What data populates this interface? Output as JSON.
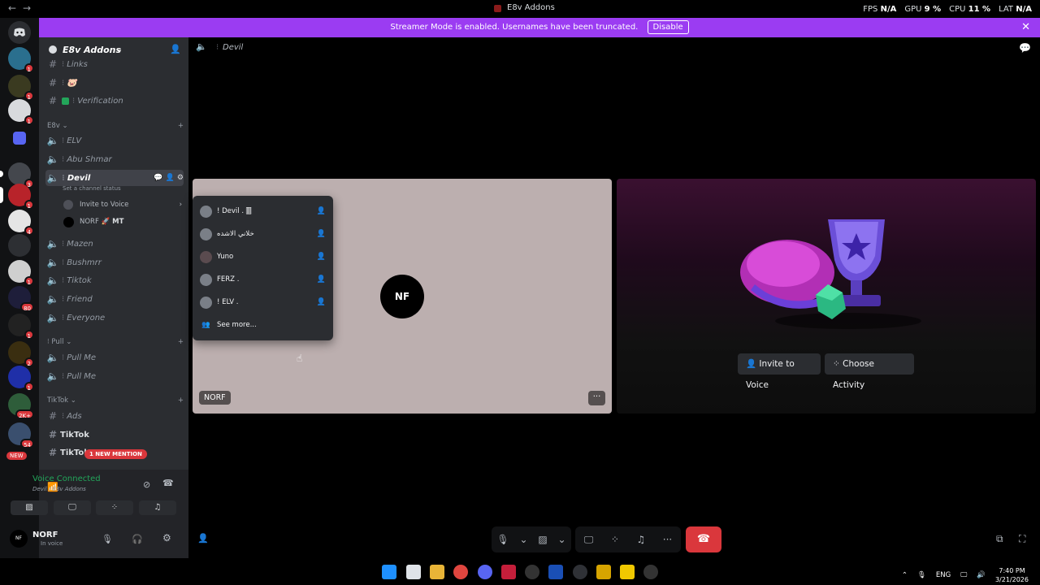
{
  "titlebar": {
    "back": "←",
    "forward": "→",
    "title": "E8v Addons",
    "fps_label": "FPS",
    "fps": "N/A",
    "gpu_label": "GPU",
    "gpu": "9 %",
    "cpu_label": "CPU",
    "cpu": "11 %",
    "lat_label": "LAT",
    "lat": "N/A"
  },
  "banner": {
    "text": "Streamer Mode is enabled. Usernames have been truncated.",
    "button": "Disable",
    "close": "✕"
  },
  "rail": {
    "badges": [
      "1",
      "1",
      "1",
      "3",
      "1",
      "4",
      "1",
      "80",
      "1",
      "2",
      "1",
      "2K+",
      "54"
    ],
    "new_label": "NEW"
  },
  "server": {
    "name": "E8v Addons"
  },
  "channels": {
    "links": "Links",
    "emoji_channel": "🐷",
    "verification": "Verification",
    "cat_e8v": "E8v",
    "elv": "ELV",
    "abu_shmar": "Abu Shmar",
    "devil": "Devil",
    "set_status": "Set a channel status",
    "invite_to_voice": "Invite to Voice",
    "norf_user": "NORF",
    "norf_tag": "🚀 MT",
    "mazen": "Mazen",
    "bushmrr": "Bushmrr",
    "tiktok": "Tiktok",
    "friend": "Friend",
    "everyone": "Everyone",
    "cat_pull": "Pull",
    "pull_me_1": "Pull Me",
    "pull_me_2": "Pull Me",
    "cat_tiktok": "TikTok",
    "ads": "Ads",
    "tiktok_text_1": "TikTok",
    "tiktok_text_2": "TikTok",
    "new_mention": "1 NEW MENTION"
  },
  "voice": {
    "status": "Voice Connected",
    "location": "Devil / E8v Addons"
  },
  "user": {
    "name": "NORF",
    "status": "In voice",
    "avatar": "NF"
  },
  "main": {
    "channel_name": "Devil"
  },
  "popup": {
    "users": [
      "! Devil . 🀫",
      "خلاني الاشده",
      "Yuno",
      "FERZ .",
      "! ELV ."
    ],
    "see_more": "See more..."
  },
  "tile": {
    "avatar_text": "NF",
    "name_label": "NORF",
    "more": "···"
  },
  "activity": {
    "invite": "Invite to Voice",
    "choose": "Choose Activity"
  },
  "taskbar": {
    "lang": "ENG",
    "time": "7:40 PM",
    "date": "3/21/2026"
  },
  "colors": {
    "banner": "#9b3cf2",
    "accent": "#5865f2",
    "danger": "#da373c",
    "voice_green": "#23a55a"
  }
}
